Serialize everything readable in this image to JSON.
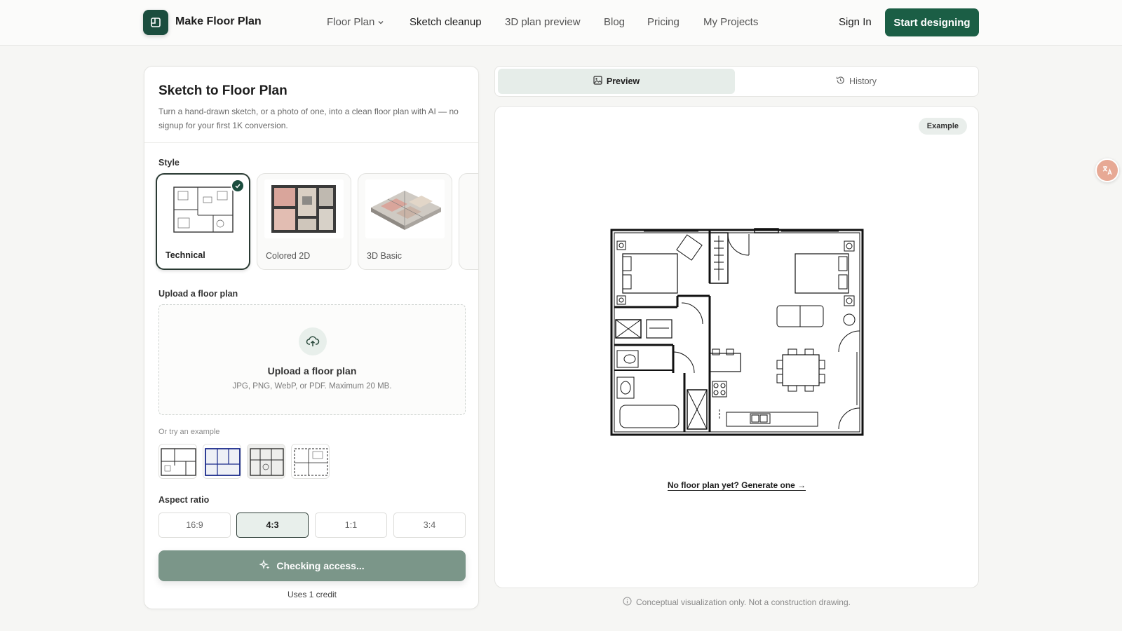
{
  "header": {
    "logo_text": "Make Floor Plan",
    "nav": [
      {
        "label": "Floor Plan"
      },
      {
        "label": "Sketch cleanup"
      },
      {
        "label": "3D plan preview"
      },
      {
        "label": "Blog"
      },
      {
        "label": "Pricing"
      },
      {
        "label": "My Projects"
      }
    ],
    "active_nav": "Sketch cleanup",
    "sign_in": "Sign In",
    "cta": "Start designing"
  },
  "left_panel": {
    "title": "Sketch to Floor Plan",
    "description": "Turn a hand-drawn sketch, or a photo of one, into a clean floor plan with AI — no signup for your first 1K conversion.",
    "style_label": "Style",
    "styles": [
      {
        "name": "Technical",
        "selected": true
      },
      {
        "name": "Colored 2D",
        "selected": false
      },
      {
        "name": "3D Basic",
        "selected": false
      }
    ],
    "upload_label": "Upload a floor plan",
    "upload_title": "Upload a floor plan",
    "upload_sub": "JPG, PNG, WebP, or PDF. Maximum 20 MB.",
    "try_label": "Or try an example",
    "aspect_label": "Aspect ratio",
    "aspect_ratios": [
      "16:9",
      "4:3",
      "1:1",
      "3:4"
    ],
    "aspect_selected": "4:3",
    "submit": "Checking access...",
    "credit_note": "Uses 1 credit"
  },
  "right_panel": {
    "tabs": [
      {
        "label": "Preview",
        "icon": "image-icon",
        "active": true
      },
      {
        "label": "History",
        "icon": "history-icon",
        "active": false
      }
    ],
    "badge": "Example",
    "generate_link": "No floor plan yet? Generate one →",
    "disclaimer": "Conceptual visualization only. Not a construction drawing."
  },
  "colors": {
    "brand": "#1b5e45",
    "brand_dark": "#1b4d3e",
    "disabled_button": "#7b9689",
    "tab_active": "#e6ede9"
  }
}
